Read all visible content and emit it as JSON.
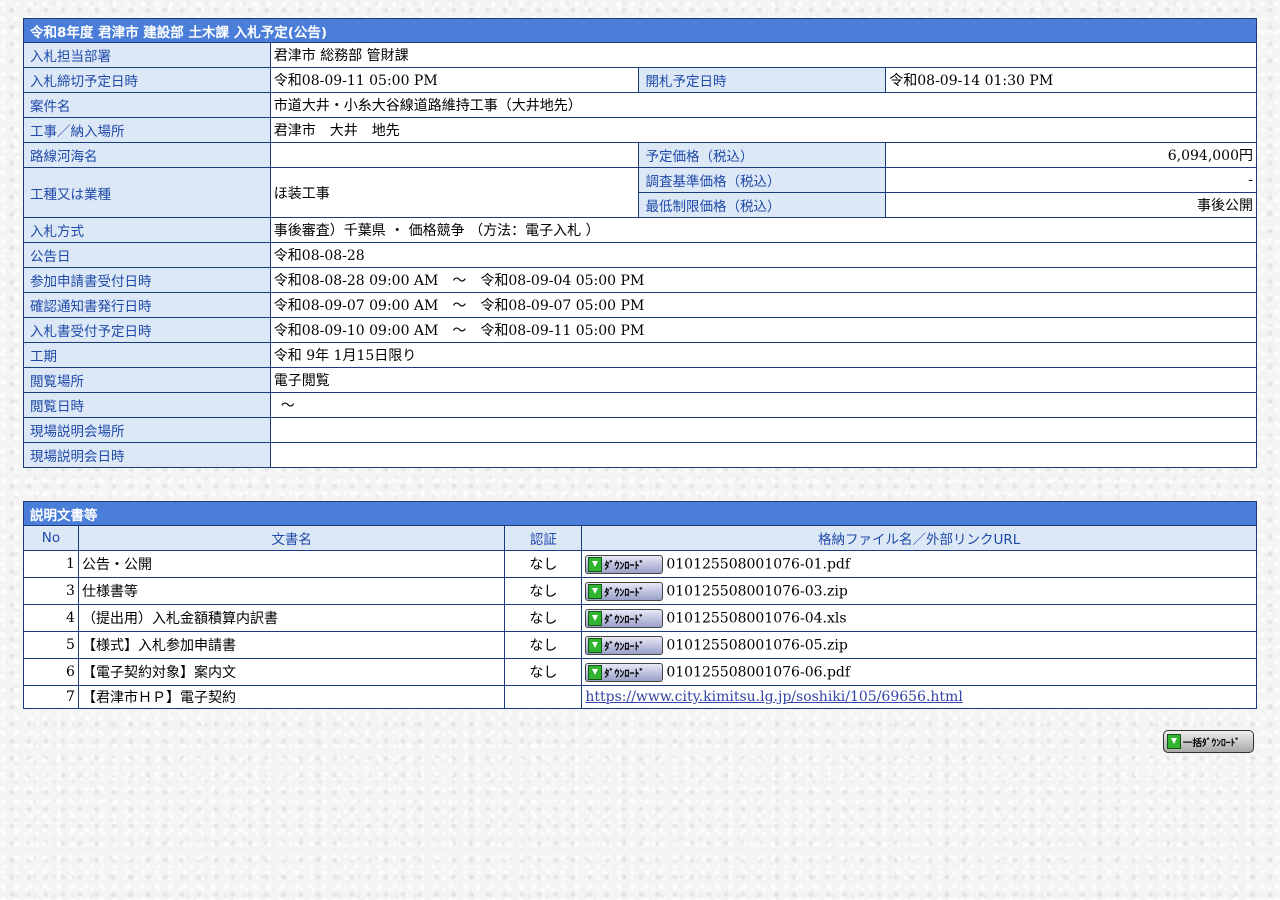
{
  "notice": {
    "title": "令和8年度 君津市 建設部 土木課 入札予定(公告)",
    "rows": {
      "dept_label": "入札担当部署",
      "dept_value": "君津市 総務部 管財課",
      "deadline_label": "入札締切予定日時",
      "deadline_value": "令和08-09-11 05:00 PM",
      "opening_label": "開札予定日時",
      "opening_value": "令和08-09-14 01:30 PM",
      "case_label": "案件名",
      "case_value": "市道大井・小糸大谷線道路維持工事（大井地先）",
      "location_label": "工事／納入場所",
      "location_value": "君津市　大井　地先",
      "route_label": "路線河海名",
      "route_value": "",
      "planned_price_label": "予定価格（税込）",
      "planned_price_value": "6,094,000円",
      "work_type_label": "工種又は業種",
      "work_type_value": "ほ装工事",
      "survey_price_label": "調査基準価格（税込）",
      "survey_price_value": "-",
      "min_price_label": "最低制限価格（税込）",
      "min_price_value": "事後公開",
      "method_label": "入札方式",
      "method_value": "事後審査）千葉県 ・ 価格競争 （方法：電子入札 ）",
      "announce_date_label": "公告日",
      "announce_date_value": "令和08-08-28",
      "application_label": "参加申請書受付日時",
      "application_value": "令和08-08-28 09:00 AM　～　令和08-09-04 05:00 PM",
      "confirm_label": "確認通知書発行日時",
      "confirm_value": "令和08-09-07 09:00 AM　～　令和08-09-07 05:00 PM",
      "bid_receipt_label": "入札書受付予定日時",
      "bid_receipt_value": "令和08-09-10 09:00 AM　～　令和08-09-11 05:00 PM",
      "period_label": "工期",
      "period_value": "令和 9年 1月15日限り",
      "viewing_place_label": "閲覧場所",
      "viewing_place_value": "電子閲覧",
      "viewing_time_label": "閲覧日時",
      "viewing_time_value": "～",
      "briefing_place_label": "現場説明会場所",
      "briefing_place_value": "",
      "briefing_time_label": "現場説明会日時",
      "briefing_time_value": ""
    }
  },
  "documents": {
    "title": "説明文書等",
    "headers": {
      "no": "No",
      "name": "文書名",
      "cert": "認証",
      "file": "格納ファイル名／外部リンクURL"
    },
    "download_label": "ﾀﾞｳﾝﾛｰﾄﾞ",
    "items": [
      {
        "no": "1",
        "name": "公告・公開",
        "cert": "なし",
        "file": "010125508001076-01.pdf"
      },
      {
        "no": "3",
        "name": "仕様書等",
        "cert": "なし",
        "file": "010125508001076-03.zip"
      },
      {
        "no": "4",
        "name": "（提出用）入札金額積算内訳書",
        "cert": "なし",
        "file": "010125508001076-04.xls"
      },
      {
        "no": "5",
        "name": "【様式】入札参加申請書",
        "cert": "なし",
        "file": "010125508001076-05.zip"
      },
      {
        "no": "6",
        "name": "【電子契約対象】案内文",
        "cert": "なし",
        "file": "010125508001076-06.pdf"
      },
      {
        "no": "7",
        "name": "【君津市ＨＰ】電子契約",
        "cert": "",
        "link": "https://www.city.kimitsu.lg.jp/soshiki/105/69656.html"
      }
    ]
  },
  "bulk_download_label": "一括ﾀﾞｳﾝﾛｰﾄﾞ",
  "colors": {
    "header_blue": "#4a7ed8",
    "label_bg": "#dde8f7",
    "label_text": "#1f4aa8",
    "border": "#1a3c7c"
  }
}
